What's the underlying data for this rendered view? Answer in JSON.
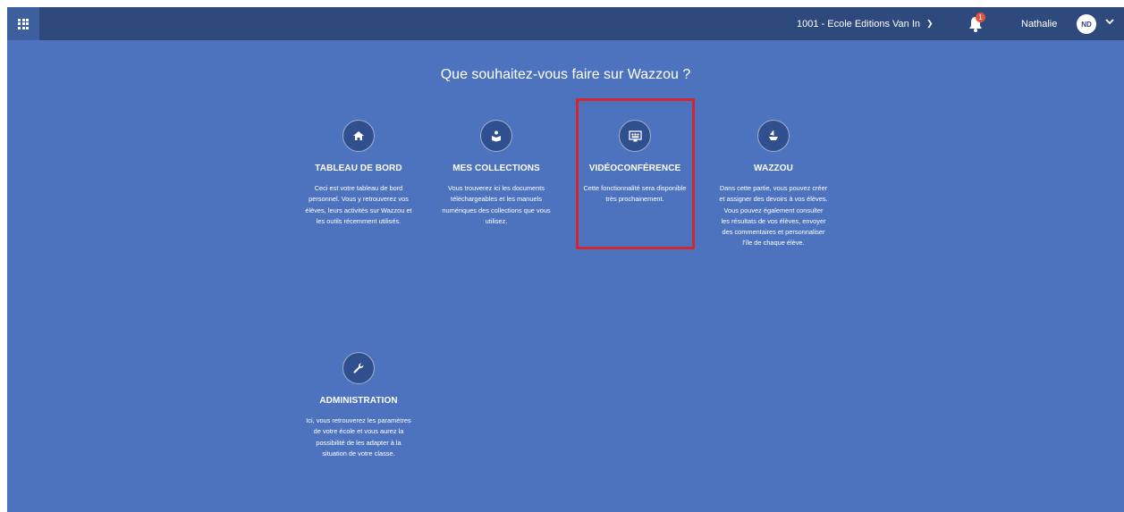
{
  "header": {
    "school_selector": "1001 - Ecole Editions Van In",
    "notification_count": "1",
    "user_name": "Nathalie",
    "user_initials": "ND"
  },
  "main": {
    "headline": "Que souhaitez-vous faire sur Wazzou ?",
    "cards": [
      {
        "icon": "home-icon",
        "title": "TABLEAU DE BORD",
        "description": "Ceci est votre tableau de bord personnel. Vous y retrouverez vos élèves, leurs activités sur Wazzou et les outils récemment utilisés."
      },
      {
        "icon": "book-reader-icon",
        "title": "MES COLLECTIONS",
        "description": "Vous trouverez ici les documents téléchargeables et les manuels numériques des collections que vous utilisez."
      },
      {
        "icon": "video-conference-icon",
        "title": "VIDÉOCONFÉRENCE",
        "description": "Cette fonctionnalité sera disponible très prochainement."
      },
      {
        "icon": "island-icon",
        "title": "WAZZOU",
        "description": "Dans cette partie, vous pouvez créer et assigner des devoirs à vos élèves. Vous pouvez également consulter les résultats de vos élèves, envoyer des commentaires et personnaliser l'île de chaque élève."
      },
      {
        "icon": "wrench-icon",
        "title": "ADMINISTRATION",
        "description": "Ici, vous retrouverez les paramètres de votre école et vous aurez la possibilité de les adapter à la situation de votre classe."
      }
    ]
  },
  "colors": {
    "background": "#4d73bf",
    "topbar": "#2e4a7d",
    "icon_circle": "#2f4f8f",
    "highlight_border": "#d22630",
    "notification_badge": "#e2533f"
  }
}
